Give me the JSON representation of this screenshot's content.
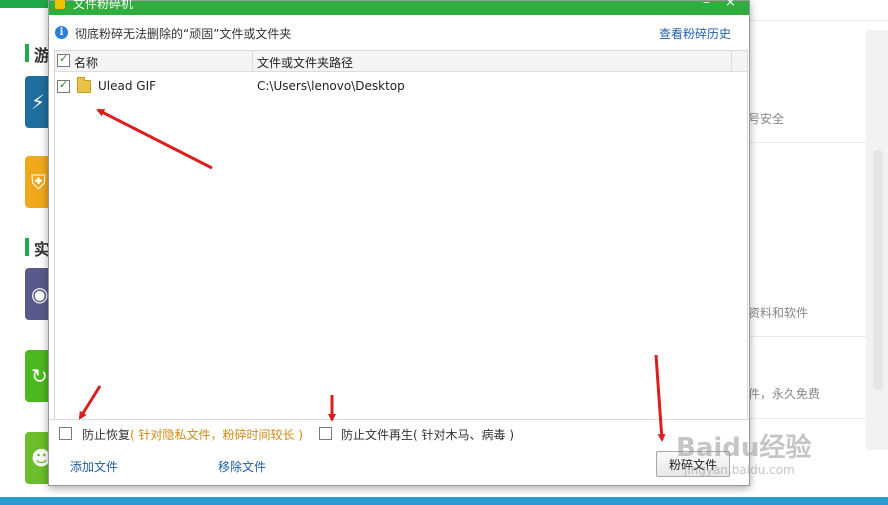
{
  "dialog": {
    "title": "文件粉碎机",
    "info_text": "彻底粉碎无法删除的“顽固”文件或文件夹",
    "history_link": "查看粉碎历史",
    "columns": [
      "名称",
      "文件或文件夹路径"
    ],
    "rows": [
      {
        "name": "Ulead GIF",
        "path": "C:\\Users\\lenovo\\Desktop",
        "checked": true
      }
    ],
    "options": {
      "prevent_recovery": "防止恢复",
      "prevent_recovery_hint": "( 针对隐私文件，粉碎时间较长 )",
      "prevent_regen": "防止文件再生",
      "prevent_regen_hint": "( 针对木马、病毒 )"
    },
    "footer": {
      "add_file": "添加文件",
      "remove_file": "移除文件",
      "shred_button": "粉碎文件"
    }
  },
  "background": {
    "section1": "游",
    "section2": "实",
    "text1": "号安全",
    "text2": "资料和软件",
    "text3": "件，永久免费"
  },
  "watermark": {
    "main": "Baidu经验",
    "sub": "jingyan.baidu.com"
  },
  "colors": {
    "titlebar": "#2fae3e",
    "link": "#1e5fa6",
    "hint": "#d08a12",
    "arrow": "#d9201e"
  }
}
